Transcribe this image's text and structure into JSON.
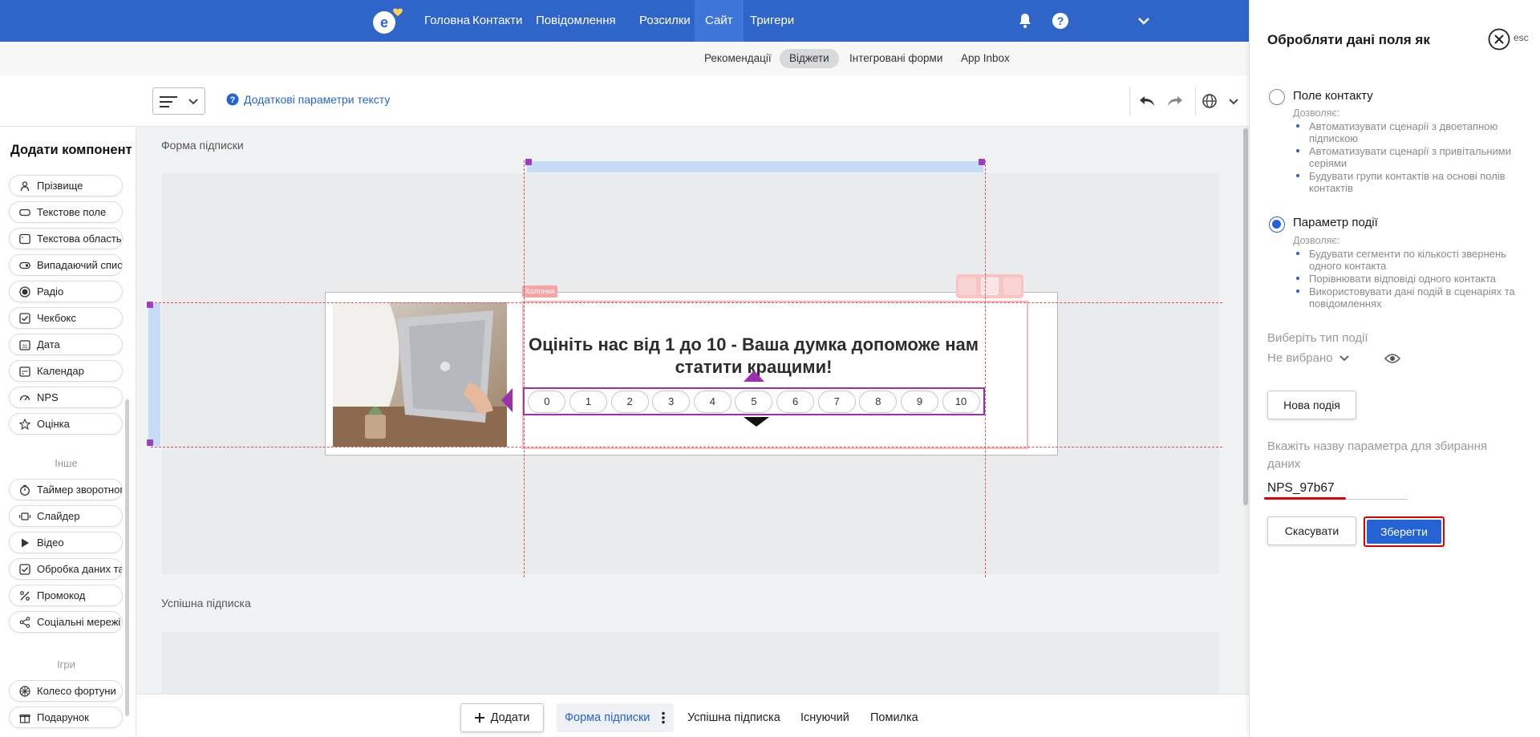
{
  "nav": {
    "items": [
      {
        "label": "Головна"
      },
      {
        "label": "Контакти"
      },
      {
        "label": "Повідомлення"
      },
      {
        "label": "Розсилки"
      },
      {
        "label": "Сайт",
        "active": true
      },
      {
        "label": "Тригери"
      }
    ]
  },
  "subnav": {
    "items": [
      {
        "label": "Рекомендації"
      },
      {
        "label": "Віджети",
        "active": true
      },
      {
        "label": "Інтегровані форми"
      },
      {
        "label": "App Inbox"
      }
    ]
  },
  "toolbar": {
    "text_params": "Додаткові параметри тексту"
  },
  "left_panel": {
    "title": "Додати компонент",
    "components": [
      {
        "label": "Прізвище",
        "icon": "person-icon"
      },
      {
        "label": "Текстове поле",
        "icon": "textfield-icon"
      },
      {
        "label": "Текстова область",
        "icon": "textarea-icon"
      },
      {
        "label": "Випадаючий список",
        "icon": "dropdown-icon"
      },
      {
        "label": "Радіо",
        "icon": "radio-icon"
      },
      {
        "label": "Чекбокс",
        "icon": "checkbox-icon"
      },
      {
        "label": "Дата",
        "icon": "date-icon"
      },
      {
        "label": "Календар",
        "icon": "calendar-icon"
      },
      {
        "label": "NPS",
        "icon": "nps-icon"
      },
      {
        "label": "Оцінка",
        "icon": "star-icon"
      }
    ],
    "section_other": "Інше",
    "other": [
      {
        "label": "Таймер зворотного відліку",
        "icon": "timer-icon"
      },
      {
        "label": "Слайдер",
        "icon": "slider-icon"
      },
      {
        "label": "Відео",
        "icon": "play-icon"
      },
      {
        "label": "Обробка даних та згода",
        "icon": "checkbox-icon"
      },
      {
        "label": "Промокод",
        "icon": "percent-icon"
      },
      {
        "label": "Соціальні мережі",
        "icon": "share-icon"
      }
    ],
    "section_games": "Ігри",
    "games": [
      {
        "label": "Колесо фортуни",
        "icon": "wheel-icon"
      },
      {
        "label": "Подарунок",
        "icon": "gift-icon"
      }
    ]
  },
  "canvas": {
    "form_label": "Форма підписки",
    "success_label": "Успішна підписка",
    "column_tag": "Колонка",
    "heading": "Оцініть нас від 1 до 10 - Ваша думка допоможе нам статити кращими!",
    "nps_values": [
      "0",
      "1",
      "2",
      "3",
      "4",
      "5",
      "6",
      "7",
      "8",
      "9",
      "10"
    ]
  },
  "bottom": {
    "add_label": "Додати",
    "tabs": [
      {
        "label": "Форма підписки",
        "active": true
      },
      {
        "label": "Успішна підписка"
      },
      {
        "label": "Існуючий"
      },
      {
        "label": "Помилка"
      }
    ]
  },
  "right_panel": {
    "title": "Обробляти дані поля як",
    "esc": "esc",
    "options": [
      {
        "label": "Поле контакту",
        "checked": false,
        "allows": "Дозволяє:",
        "items": [
          "Автоматизувати сценарії з двоетапною підпискою",
          "Автоматизувати сценарії з привітальними серіями",
          "Будувати групи контактів на основі полів контактів"
        ]
      },
      {
        "label": "Параметр події",
        "checked": true,
        "allows": "Дозволяє:",
        "items": [
          "Будувати сегменти по кількості звернень одного контакта",
          "Порівнювати відповіді одного контакта",
          "Використовувати дані подій в сценаріях та повідомленнях"
        ]
      }
    ],
    "event_type_label": "Виберіть тип події",
    "event_type_value": "Не вибрано",
    "new_event": "Нова подія",
    "param_label": "Вкажіть назву параметра для збирання даних",
    "param_value": "NPS_97b67",
    "cancel": "Скасувати",
    "save": "Зберегти"
  },
  "colors": {
    "nav_bg": "#2f65c9",
    "accent": "#2563d4",
    "selection": "#9b2fae",
    "highlight_red": "#e00000"
  }
}
